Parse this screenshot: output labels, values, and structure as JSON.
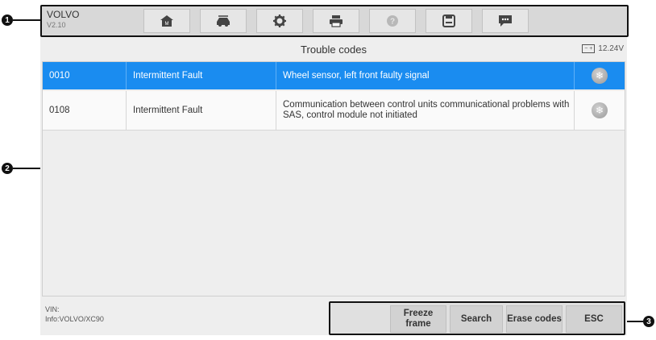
{
  "header": {
    "app_name": "VOLVO",
    "version": "V2.10",
    "toolbar": [
      {
        "icon": "home-icon"
      },
      {
        "icon": "vehicle-swap-icon"
      },
      {
        "icon": "settings-gear-icon"
      },
      {
        "icon": "printer-icon"
      },
      {
        "icon": "help-icon"
      },
      {
        "icon": "save-icon"
      },
      {
        "icon": "message-icon"
      }
    ]
  },
  "page": {
    "title": "Trouble codes",
    "battery_voltage": "12.24V"
  },
  "codes": [
    {
      "code": "0010",
      "status": "Intermittent Fault",
      "description": "Wheel sensor, left front faulty signal",
      "selected": true
    },
    {
      "code": "0108",
      "status": "Intermittent Fault",
      "description": "Communication between control units communicational problems with SAS, control module not initiated",
      "selected": false
    }
  ],
  "footer": {
    "vin_label": "VIN:",
    "info_label": "Info:VOLVO/XC90",
    "buttons": {
      "freeze_frame": "Freeze frame",
      "search": "Search",
      "erase_codes": "Erase codes",
      "esc": "ESC"
    }
  },
  "callouts": [
    "1",
    "2",
    "3"
  ],
  "colors": {
    "selected_row": "#1a8cf0",
    "toolbar_bg": "#d8d8d8",
    "button_bg": "#d2d2d2"
  }
}
